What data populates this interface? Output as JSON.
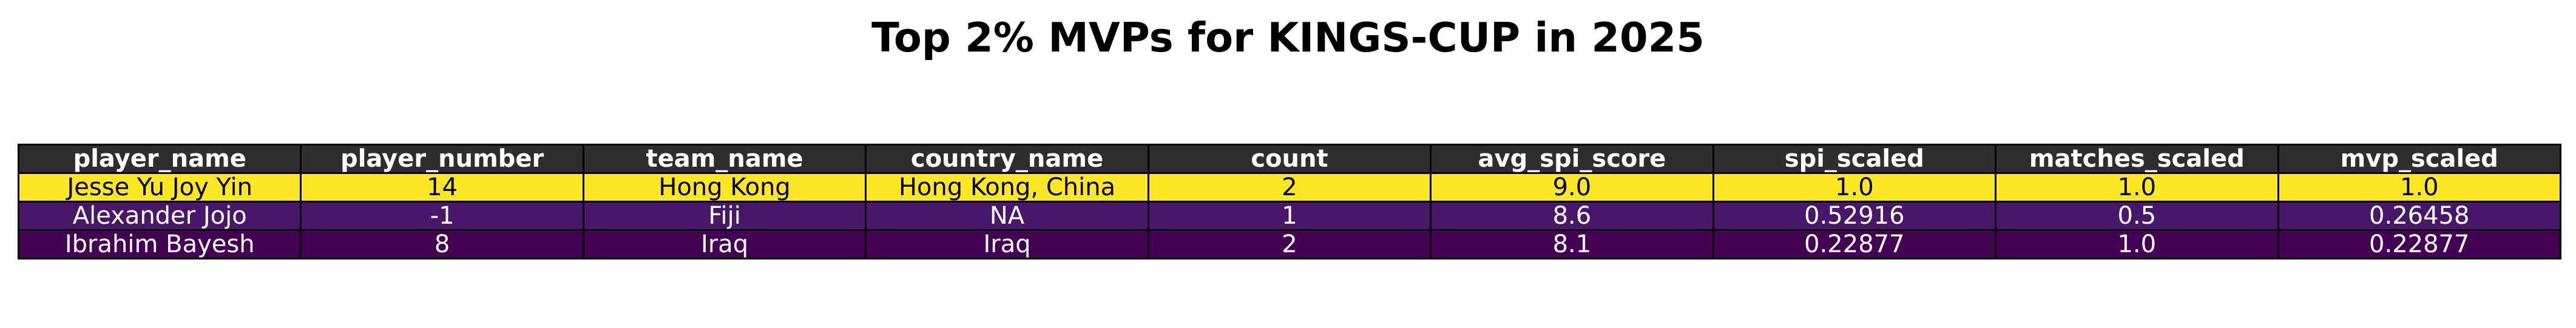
{
  "chart_data": {
    "type": "table",
    "title": "Top 2% MVPs for KINGS-CUP in 2025",
    "header_color": "#2e2e2e",
    "columns": [
      "player_name",
      "player_number",
      "team_name",
      "country_name",
      "count",
      "avg_spi_score",
      "spi_scaled",
      "matches_scaled",
      "mvp_scaled"
    ],
    "rows": [
      {
        "cells": [
          "Jesse Yu Joy Yin",
          "14",
          "Hong Kong",
          "Hong Kong, China",
          "2",
          "9.0",
          "1.0",
          "1.0",
          "1.0"
        ],
        "bg": "#fde725",
        "fg": "#000000"
      },
      {
        "cells": [
          "Alexander Jojo",
          "-1",
          "Fiji",
          "NA",
          "1",
          "8.6",
          "0.52916",
          "0.5",
          "0.26458"
        ],
        "bg": "#48176a",
        "fg": "#ffffff"
      },
      {
        "cells": [
          "Ibrahim Bayesh",
          "8",
          "Iraq",
          "Iraq",
          "2",
          "8.1",
          "0.22877",
          "1.0",
          "0.22877"
        ],
        "bg": "#440154",
        "fg": "#ffffff"
      }
    ]
  }
}
